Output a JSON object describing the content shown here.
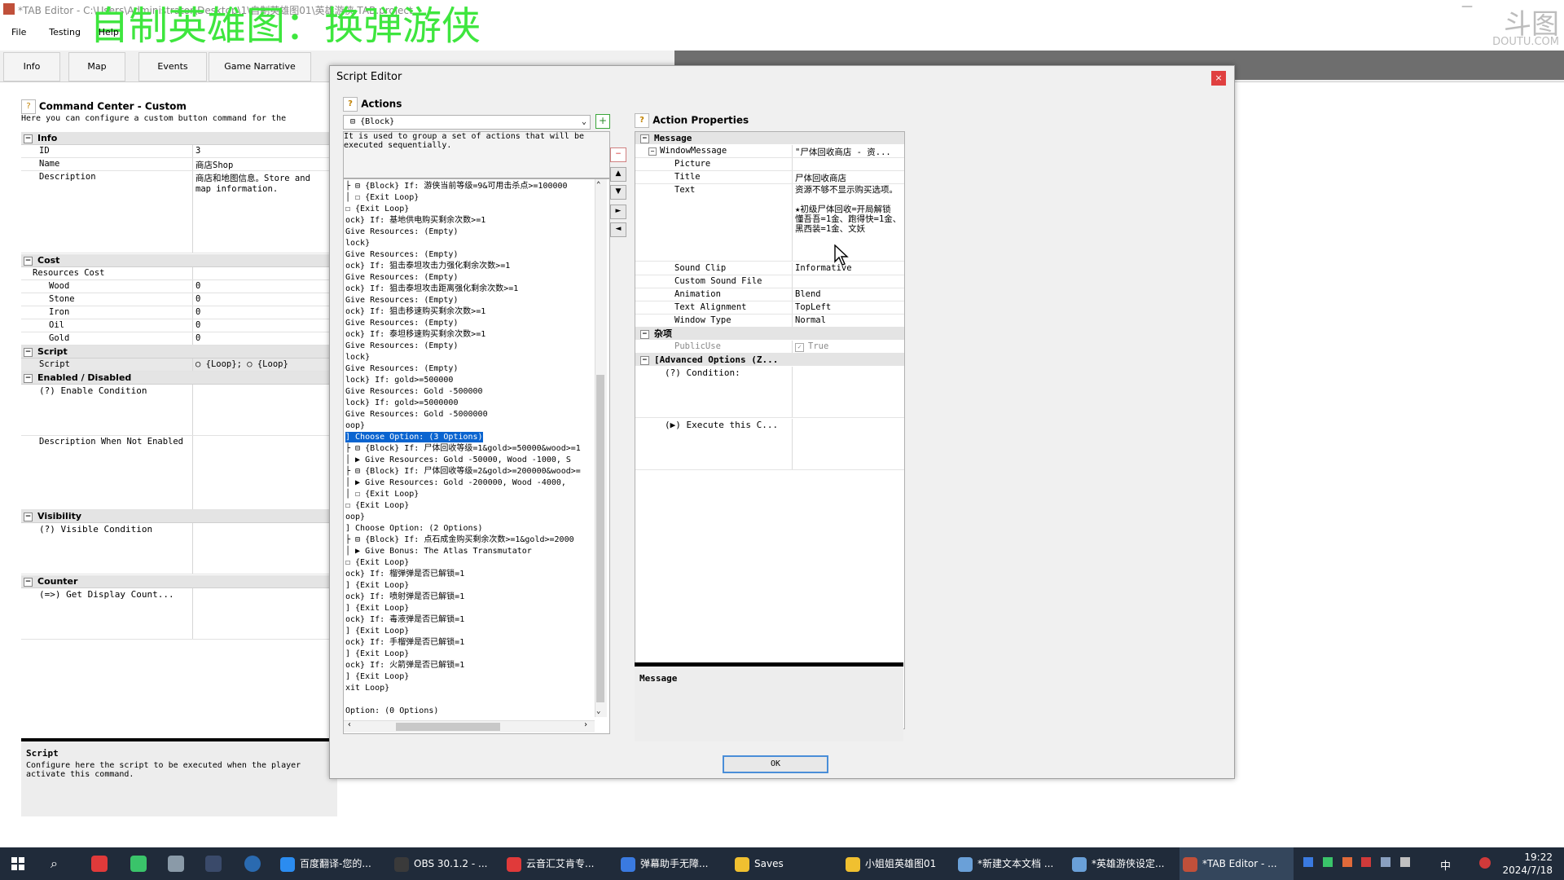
{
  "app": {
    "title": "*TAB Editor - C:\\Users\\Administrator\\Desktop\\1\\自制英雄图01\\英雄游侠.TAB.project",
    "overlay_title": "自制英雄图：换弹游侠",
    "watermark": "斗图",
    "watermark_sub": "DOUTU.COM",
    "minimize": "—"
  },
  "menu": [
    "File",
    "Testing",
    "Help"
  ],
  "tabs": [
    "Info",
    "Map",
    "Events",
    "Game Narrative"
  ],
  "left": {
    "title": "Command Center - Custom",
    "subtitle": "Here you can configure a custom button command for the",
    "info": {
      "section": "Info",
      "id_label": "ID",
      "id_value": "3",
      "name_label": "Name",
      "name_value": "商店Shop",
      "desc_label": "Description",
      "desc_value": "商店和地图信息。Store and map information."
    },
    "cost": {
      "section": "Cost",
      "resources_label": "Resources Cost",
      "items": [
        {
          "label": "Wood",
          "value": "0"
        },
        {
          "label": "Stone",
          "value": "0"
        },
        {
          "label": "Iron",
          "value": "0"
        },
        {
          "label": "Oil",
          "value": "0"
        },
        {
          "label": "Gold",
          "value": "0"
        }
      ]
    },
    "script": {
      "section": "Script",
      "label": "Script",
      "value": "○ {Loop};  ○ {Loop}"
    },
    "enabled": {
      "section": "Enabled / Disabled",
      "condition": "(?) Enable Condition",
      "desc_not_enabled": "Description When Not Enabled"
    },
    "visibility": {
      "section": "Visibility",
      "condition": "(?) Visible Condition"
    },
    "counter": {
      "section": "Counter",
      "display": "(=>) Get Display Count..."
    },
    "footer_title": "Script",
    "footer_text": "Configure here the script to be executed when the player activate this command."
  },
  "dialog": {
    "title": "Script Editor",
    "close": "×",
    "actions_label": "Actions",
    "action_selected": "{Block}",
    "add": "+",
    "action_desc": "It is used to group a set of actions that will be executed sequentially.",
    "tree": [
      "├ ⊟ {Block} If: 游侠当前等级=9&可用击杀点>=100000",
      "│   ☐ {Exit Loop}",
      "  ☐ {Exit Loop}",
      "ock} If: 基地供电购买剩余次数>=1",
      " Give Resources: (Empty)",
      "lock}",
      " Give Resources: (Empty)",
      "ock} If: 狙击泰坦攻击力强化剩余次数>=1",
      " Give Resources: (Empty)",
      "ock} If: 狙击泰坦攻击距离强化剩余次数>=1",
      " Give Resources: (Empty)",
      "ock} If: 狙击移速购买剩余次数>=1",
      " Give Resources: (Empty)",
      "ock} If: 泰坦移速购买剩余次数>=1",
      " Give Resources: (Empty)",
      "lock}",
      " Give Resources: (Empty)",
      "lock} If: gold>=500000",
      " Give Resources: Gold -500000",
      "lock} If: gold>=5000000",
      " Give Resources: Gold -5000000",
      "oop}",
      "] Choose Option: (3 Options)",
      "├ ⊟ {Block} If: 尸体回收等级=1&gold>=50000&wood>=1",
      "│   ▶ Give Resources: Gold -50000, Wood -1000, S",
      "├ ⊟ {Block} If: 尸体回收等级=2&gold>=200000&wood>=",
      "│   ▶ Give Resources: Gold -200000, Wood -4000,",
      "│   ☐ {Exit Loop}",
      "  ☐ {Exit Loop}",
      "oop}",
      "] Choose Option: (2 Options)",
      "├ ⊟ {Block} If: 点石成金购买剩余次数>=1&gold>=2000",
      "│   ▶ Give Bonus: The Atlas Transmutator",
      "  ☐ {Exit Loop}",
      "ock} If: 榴弹弹是否已解锁=1",
      "] {Exit Loop}",
      "ock} If: 喷射弹是否已解锁=1",
      "] {Exit Loop}",
      "ock} If: 毒液弹是否已解锁=1",
      "] {Exit Loop}",
      "ock} If: 手榴弹是否已解锁=1",
      "] {Exit Loop}",
      "ock} If: 火箭弹是否已解锁=1",
      "] {Exit Loop}",
      "xit Loop}",
      "",
      " Option: (0 Options)"
    ],
    "selected_tree_index": 22,
    "side_buttons": [
      "−",
      "▲",
      "▼",
      "►",
      "◄"
    ],
    "props_label": "Action Properties",
    "props": {
      "message_section": "Message",
      "window_message_label": "WindowMessage",
      "window_message_value": "\"尸体回收商店 - 资...",
      "picture_label": "Picture",
      "picture_value": "",
      "title_label": "Title",
      "title_value": "尸体回收商店",
      "text_label": "Text",
      "text_value": "资源不够不显示购买选项。\n\n★初级尸体回收=开局解锁\n懂吾吾=1金、跑得快=1金、黑西装=1金、文妖",
      "sound_clip_label": "Sound Clip",
      "sound_clip_value": "Informative",
      "custom_sound_label": "Custom Sound File",
      "custom_sound_value": "",
      "animation_label": "Animation",
      "animation_value": "Blend",
      "text_alignment_label": "Text Alignment",
      "text_alignment_value": "TopLeft",
      "window_type_label": "Window Type",
      "window_type_value": "Normal",
      "misc_section": "杂项",
      "public_use_label": "PublicUse",
      "public_use_value": "True",
      "advanced_section": "[Advanced Options (Z...",
      "condition": "(?) Condition:",
      "execute": "(▶) Execute this C..."
    },
    "props_footer": "Message",
    "ok": "OK"
  },
  "taskbar": {
    "apps": [
      {
        "label": "百度翻译-您的...",
        "color": "#2b8cf0"
      },
      {
        "label": "OBS 30.1.2 - ...",
        "color": "#3a3a3a"
      },
      {
        "label": "云音汇艾肯专...",
        "color": "#e03a3a"
      },
      {
        "label": "弹幕助手无障...",
        "color": "#3a7ae0"
      },
      {
        "label": "Saves",
        "color": "#f0c030"
      },
      {
        "label": "小姐姐英雄图01",
        "color": "#f0c030"
      },
      {
        "label": "*新建文本文档 ...",
        "color": "#6aa0d8"
      },
      {
        "label": "*英雄游侠设定...",
        "color": "#6aa0d8"
      },
      {
        "label": "*TAB Editor - ...",
        "color": "#c0503a"
      }
    ],
    "ime": "中",
    "time": "19:22",
    "date": "2024/7/18"
  }
}
